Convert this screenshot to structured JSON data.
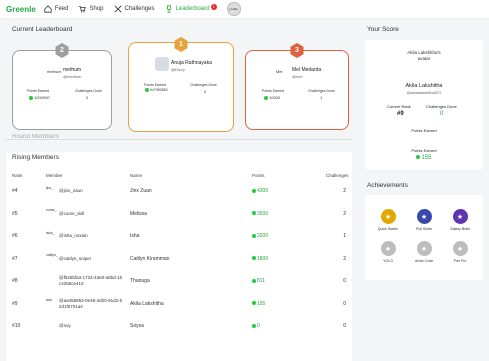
{
  "nav": {
    "logo": "Greenle",
    "items": [
      {
        "label": "Feed",
        "icon": "home-icon"
      },
      {
        "label": "Shop",
        "icon": "cart-icon"
      },
      {
        "label": "Challenges",
        "icon": "swords-icon"
      },
      {
        "label": "Leaderboard",
        "icon": "trophy-icon"
      }
    ],
    "notif_count": "1",
    "avatar_alt": "profile"
  },
  "leaderboard": {
    "title": "Current Leaderboard",
    "cards": [
      {
        "rank": "2",
        "name": "methum",
        "username": "@methum",
        "avatar_alt": "methum",
        "points_label": "Points Earned",
        "points": "1000000",
        "challenges_label": "Challenges Done",
        "challenges": "0",
        "color": "#9e9e9e"
      },
      {
        "rank": "1",
        "name": "Anuja Rathnayaka",
        "username": "@Dizzy",
        "avatar_alt": "",
        "points_label": "Points Earned",
        "points": "947982883",
        "challenges_label": "Challenges Done",
        "challenges": "0",
        "color": "#e6a23c"
      },
      {
        "rank": "3",
        "name": "Mel Medarda",
        "username": "@mel",
        "avatar_alt": "Mel",
        "points_label": "Points Earned",
        "points": "10000",
        "challenges_label": "Challenges Done",
        "challenges": "1",
        "color": "#e0613f"
      }
    ]
  },
  "rising": {
    "ghost_title": "Rising Members",
    "title": "Rising Members",
    "columns": {
      "rank": "Rank",
      "member": "Member",
      "name": "Name",
      "points": "Points",
      "challenges": "Challenges"
    },
    "rows": [
      {
        "rank": "#4",
        "alt": "jinx_",
        "handle": "@jinx_zaun",
        "name": "Jinx Zuan",
        "points": "4300",
        "challenges": "2"
      },
      {
        "rank": "#5",
        "alt": "curse_",
        "handle": "@curse_doll",
        "name": "Melissa",
        "points": "3500",
        "challenges": "2"
      },
      {
        "rank": "#6",
        "alt": "isha_",
        "handle": "@isha_noxian",
        "name": "Isha",
        "points": "3200",
        "challenges": "1"
      },
      {
        "rank": "#7",
        "alt": "caitlyn_",
        "handle": "@caitlyn_sniper",
        "name": "Caitlyn Kiramman",
        "points": "1800",
        "challenges": "2"
      },
      {
        "rank": "#8",
        "alt": "",
        "handle": "@f826bfa3-1732-43e0-a0bd-1bc4255ce410",
        "name": "Thanuga",
        "points": "811",
        "challenges": "0"
      },
      {
        "rank": "#9",
        "alt": "aa4",
        "handle": "@aa456853-0e46-4d20-81d2-b2d1f0701a4",
        "name": "Akila Lakshitha",
        "points": "155",
        "challenges": "0"
      },
      {
        "rank": "#10",
        "alt": "",
        "handle": "@soy",
        "name": "Soysa",
        "points": "0",
        "challenges": "0"
      }
    ]
  },
  "score": {
    "title": "Your Score",
    "avatar_alt": "Akila Lakshitha's avatar",
    "name": "Akila Lakshitha",
    "username": "@akilalakshitha572",
    "rank_label": "Current Rank",
    "rank": "#9",
    "challenges_label": "Challenges Done",
    "challenges": "0",
    "points_label": "Points Earned",
    "points_label2": "Points Earned",
    "points": "155"
  },
  "achievements": {
    "title": "Achievements",
    "items": [
      {
        "label": "Quick Starter",
        "icon": "dog-badge-icon",
        "color": "#e0a800"
      },
      {
        "label": "Pull Shark",
        "icon": "shark-badge-icon",
        "color": "#3949ab"
      },
      {
        "label": "Galaxy Brain",
        "icon": "brain-badge-icon",
        "color": "#5e35b1"
      },
      {
        "label": "YOLO",
        "icon": "yolo-badge-icon",
        "color": "#bdbdbd"
      },
      {
        "label": "Arctic Code",
        "icon": "arctic-badge-icon",
        "color": "#bdbdbd"
      },
      {
        "label": "Pair Pro",
        "icon": "pair-badge-icon",
        "color": "#bdbdbd"
      }
    ]
  },
  "colors": {
    "accent": "#28a745"
  }
}
